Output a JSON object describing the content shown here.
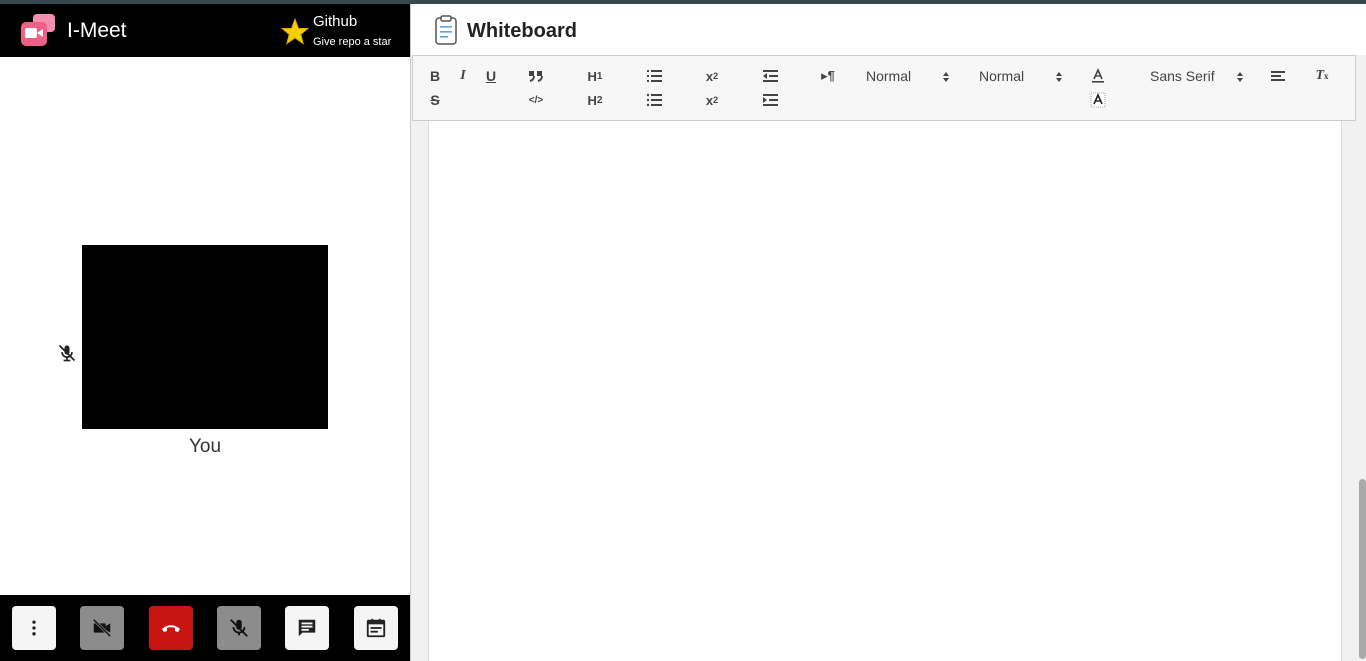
{
  "app": {
    "title": "I-Meet"
  },
  "github": {
    "title": "Github",
    "subtitle": "Give repo a star"
  },
  "participant": {
    "label": "You"
  },
  "whiteboard": {
    "title": "Whiteboard",
    "toolbar": {
      "header_picker": "Normal",
      "size_picker": "Normal",
      "font_picker": "Sans Serif"
    }
  },
  "controls": [
    "more-options",
    "camera-off",
    "end-call",
    "mic-off",
    "chat",
    "notes"
  ],
  "colors": {
    "end_call": "#c91414",
    "header_bg": "#000000"
  }
}
